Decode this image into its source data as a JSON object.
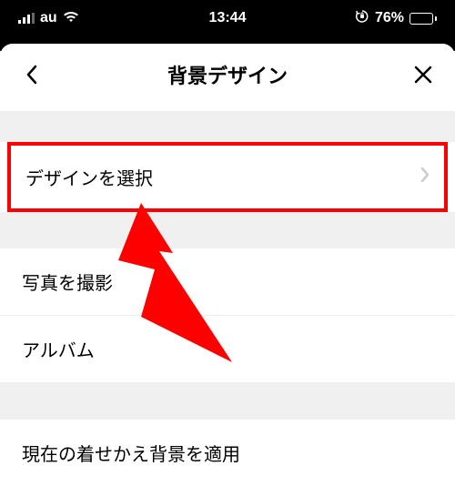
{
  "statusBar": {
    "carrier": "au",
    "time": "13:44",
    "batteryPercent": "76%"
  },
  "nav": {
    "title": "背景デザイン"
  },
  "items": {
    "selectDesign": "デザインを選択",
    "takePhoto": "写真を撮影",
    "album": "アルバム",
    "applyCurrentTheme": "現在の着せかえ背景を適用"
  }
}
